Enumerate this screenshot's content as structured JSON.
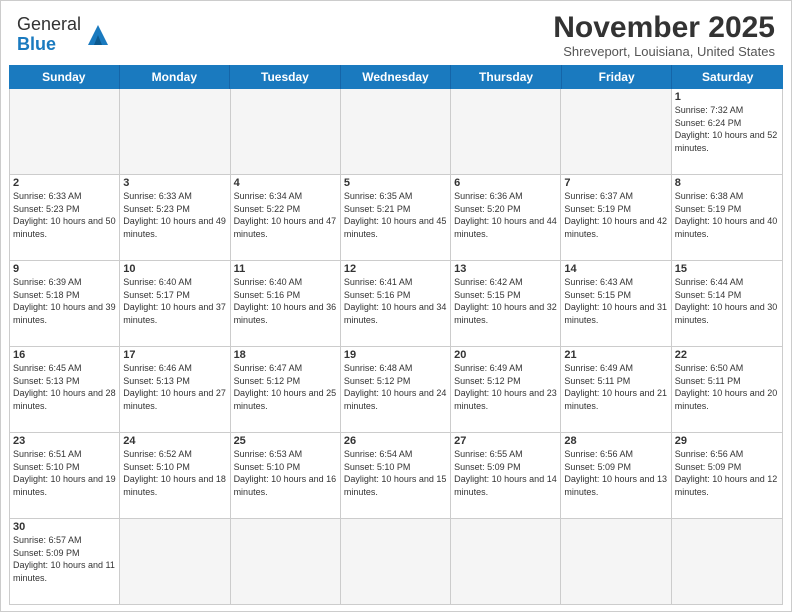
{
  "header": {
    "logo_text_general": "General",
    "logo_text_blue": "Blue",
    "month_year": "November 2025",
    "location": "Shreveport, Louisiana, United States"
  },
  "days_of_week": [
    "Sunday",
    "Monday",
    "Tuesday",
    "Wednesday",
    "Thursday",
    "Friday",
    "Saturday"
  ],
  "weeks": [
    [
      {
        "day": "",
        "empty": true
      },
      {
        "day": "",
        "empty": true
      },
      {
        "day": "",
        "empty": true
      },
      {
        "day": "",
        "empty": true
      },
      {
        "day": "",
        "empty": true
      },
      {
        "day": "",
        "empty": true
      },
      {
        "day": "1",
        "sunrise": "7:32 AM",
        "sunset": "6:24 PM",
        "daylight": "10 hours and 52 minutes."
      }
    ],
    [
      {
        "day": "2",
        "sunrise": "6:33 AM",
        "sunset": "5:23 PM",
        "daylight": "10 hours and 50 minutes."
      },
      {
        "day": "3",
        "sunrise": "6:33 AM",
        "sunset": "5:23 PM",
        "daylight": "10 hours and 49 minutes."
      },
      {
        "day": "4",
        "sunrise": "6:34 AM",
        "sunset": "5:22 PM",
        "daylight": "10 hours and 47 minutes."
      },
      {
        "day": "5",
        "sunrise": "6:35 AM",
        "sunset": "5:21 PM",
        "daylight": "10 hours and 45 minutes."
      },
      {
        "day": "6",
        "sunrise": "6:36 AM",
        "sunset": "5:20 PM",
        "daylight": "10 hours and 44 minutes."
      },
      {
        "day": "7",
        "sunrise": "6:37 AM",
        "sunset": "5:19 PM",
        "daylight": "10 hours and 42 minutes."
      },
      {
        "day": "8",
        "sunrise": "6:38 AM",
        "sunset": "5:19 PM",
        "daylight": "10 hours and 40 minutes."
      }
    ],
    [
      {
        "day": "9",
        "sunrise": "6:39 AM",
        "sunset": "5:18 PM",
        "daylight": "10 hours and 39 minutes."
      },
      {
        "day": "10",
        "sunrise": "6:40 AM",
        "sunset": "5:17 PM",
        "daylight": "10 hours and 37 minutes."
      },
      {
        "day": "11",
        "sunrise": "6:40 AM",
        "sunset": "5:16 PM",
        "daylight": "10 hours and 36 minutes."
      },
      {
        "day": "12",
        "sunrise": "6:41 AM",
        "sunset": "5:16 PM",
        "daylight": "10 hours and 34 minutes."
      },
      {
        "day": "13",
        "sunrise": "6:42 AM",
        "sunset": "5:15 PM",
        "daylight": "10 hours and 32 minutes."
      },
      {
        "day": "14",
        "sunrise": "6:43 AM",
        "sunset": "5:15 PM",
        "daylight": "10 hours and 31 minutes."
      },
      {
        "day": "15",
        "sunrise": "6:44 AM",
        "sunset": "5:14 PM",
        "daylight": "10 hours and 30 minutes."
      }
    ],
    [
      {
        "day": "16",
        "sunrise": "6:45 AM",
        "sunset": "5:13 PM",
        "daylight": "10 hours and 28 minutes."
      },
      {
        "day": "17",
        "sunrise": "6:46 AM",
        "sunset": "5:13 PM",
        "daylight": "10 hours and 27 minutes."
      },
      {
        "day": "18",
        "sunrise": "6:47 AM",
        "sunset": "5:12 PM",
        "daylight": "10 hours and 25 minutes."
      },
      {
        "day": "19",
        "sunrise": "6:48 AM",
        "sunset": "5:12 PM",
        "daylight": "10 hours and 24 minutes."
      },
      {
        "day": "20",
        "sunrise": "6:49 AM",
        "sunset": "5:12 PM",
        "daylight": "10 hours and 23 minutes."
      },
      {
        "day": "21",
        "sunrise": "6:49 AM",
        "sunset": "5:11 PM",
        "daylight": "10 hours and 21 minutes."
      },
      {
        "day": "22",
        "sunrise": "6:50 AM",
        "sunset": "5:11 PM",
        "daylight": "10 hours and 20 minutes."
      }
    ],
    [
      {
        "day": "23",
        "sunrise": "6:51 AM",
        "sunset": "5:10 PM",
        "daylight": "10 hours and 19 minutes."
      },
      {
        "day": "24",
        "sunrise": "6:52 AM",
        "sunset": "5:10 PM",
        "daylight": "10 hours and 18 minutes."
      },
      {
        "day": "25",
        "sunrise": "6:53 AM",
        "sunset": "5:10 PM",
        "daylight": "10 hours and 16 minutes."
      },
      {
        "day": "26",
        "sunrise": "6:54 AM",
        "sunset": "5:10 PM",
        "daylight": "10 hours and 15 minutes."
      },
      {
        "day": "27",
        "sunrise": "6:55 AM",
        "sunset": "5:09 PM",
        "daylight": "10 hours and 14 minutes."
      },
      {
        "day": "28",
        "sunrise": "6:56 AM",
        "sunset": "5:09 PM",
        "daylight": "10 hours and 13 minutes."
      },
      {
        "day": "29",
        "sunrise": "6:56 AM",
        "sunset": "5:09 PM",
        "daylight": "10 hours and 12 minutes."
      }
    ],
    [
      {
        "day": "30",
        "sunrise": "6:57 AM",
        "sunset": "5:09 PM",
        "daylight": "10 hours and 11 minutes."
      },
      {
        "day": "",
        "empty": true
      },
      {
        "day": "",
        "empty": true
      },
      {
        "day": "",
        "empty": true
      },
      {
        "day": "",
        "empty": true
      },
      {
        "day": "",
        "empty": true
      },
      {
        "day": "",
        "empty": true
      }
    ]
  ]
}
